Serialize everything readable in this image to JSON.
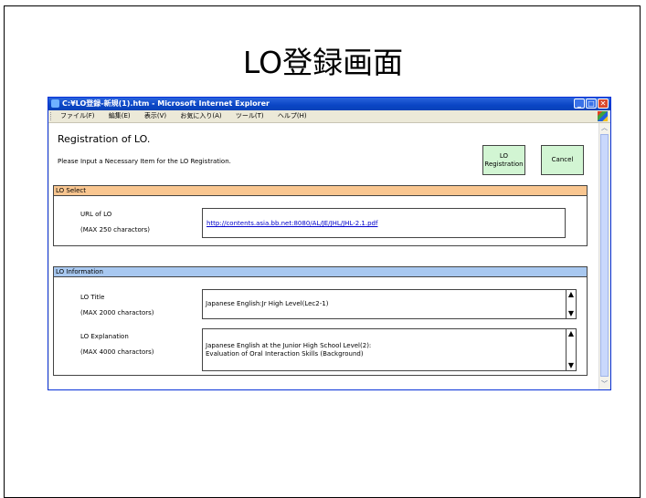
{
  "slide": {
    "title": "LO登録画面"
  },
  "window": {
    "title": "C:¥LO登録-新規(1).htm - Microsoft Internet Explorer",
    "menu": [
      "ファイル(F)",
      "編集(E)",
      "表示(V)",
      "お気に入り(A)",
      "ツール(T)",
      "ヘルプ(H)"
    ]
  },
  "page": {
    "heading": "Registration of LO.",
    "instruction": "Please Input a Necessary Item for the LO Registration.",
    "buttons": {
      "register_line1": "LO",
      "register_line2": "Registration",
      "cancel": "Cancel"
    }
  },
  "lo_select": {
    "header": "LO Select",
    "url_label": "URL of LO",
    "url_limit": "(MAX 250 charactors)",
    "url_value": "http://contents.asia.bb.net:8080/AL/JE/JHL/JHL-2.1.pdf"
  },
  "lo_info": {
    "header": "LO Information",
    "title_label": "LO Title",
    "title_limit": "(MAX 2000 charactors)",
    "title_value": "Japanese English:Jr High Level(Lec2-1)",
    "expl_label": "LO Explanation",
    "expl_limit": "(MAX 4000 charactors)",
    "expl_line1": "Japanese English at the Junior High School Level(2):",
    "expl_line2": "Evaluation of Oral Interaction Skills (Background)"
  },
  "colors": {
    "select_header": "#f9c690",
    "info_header": "#a8c8f0",
    "button_bg": "#d2f5d3",
    "titlebar": "#0a45c4"
  }
}
